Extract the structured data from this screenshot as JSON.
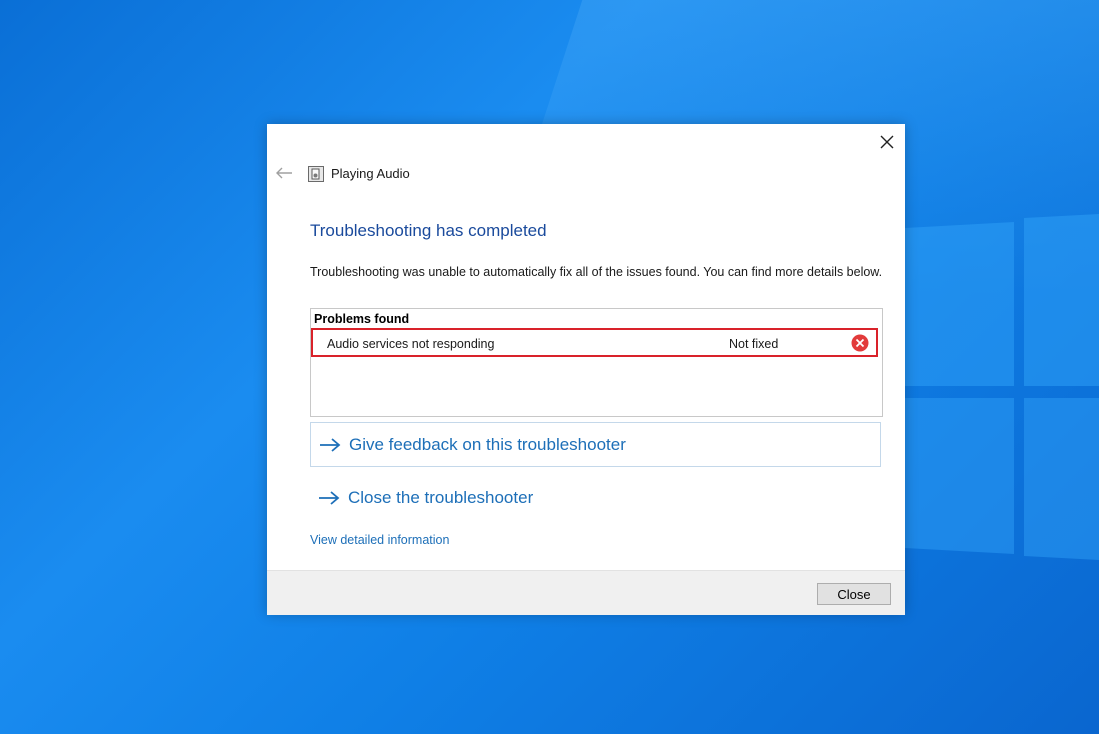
{
  "window": {
    "app_title": "Playing Audio"
  },
  "content": {
    "heading": "Troubleshooting has completed",
    "description": "Troubleshooting was unable to automatically fix all of the issues found. You can find more details below."
  },
  "problems": {
    "header": "Problems found",
    "items": [
      {
        "name": "Audio services not responding",
        "status": "Not fixed",
        "status_icon": "error-circle-icon"
      }
    ]
  },
  "links": {
    "feedback": "Give feedback on this troubleshooter",
    "close": "Close the troubleshooter",
    "details": "View detailed information"
  },
  "footer": {
    "close_button": "Close"
  },
  "colors": {
    "heading": "#1a4a9c",
    "link": "#1d6fb8",
    "highlight": "#d9222a",
    "error": "#e23b3b",
    "desktop": "#0a78e0"
  }
}
